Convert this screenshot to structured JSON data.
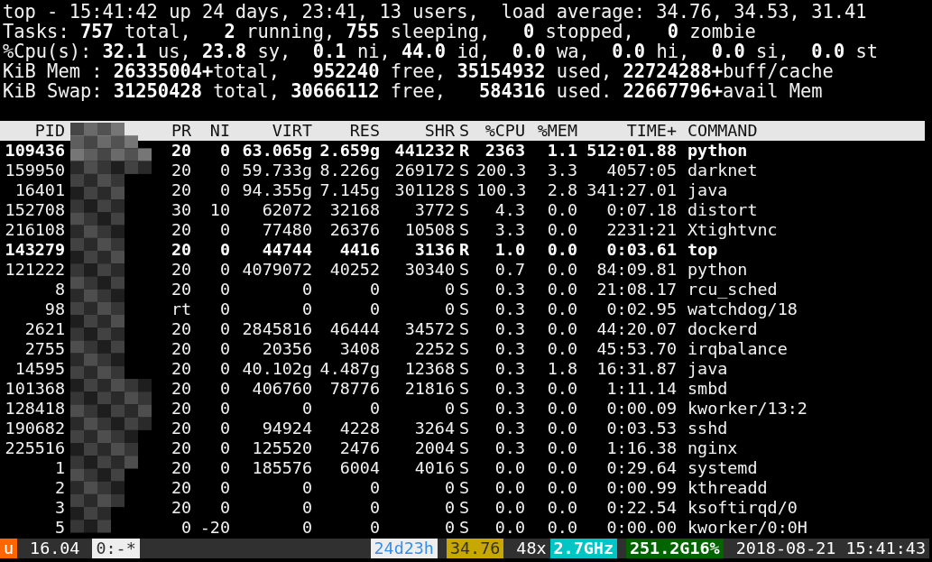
{
  "summary": [
    "top - 15:41:42 up 24 days, 23:41, 13 users,  load average: 34.76, 34.53, 31.41",
    "Tasks: **757** total,   **2** running, **755** sleeping,   **0** stopped,   **0** zombie",
    "%Cpu(s): **32.1** us, **23.8** sy,  **0.1** ni, **44.0** id,  **0.0** wa,  **0.0** hi,  **0.0** si,  **0.0** st",
    "KiB Mem : **26335004+**total,   **952240** free, **35154932** used, **22724288+**buff/cache",
    "KiB Swap: **31250428** total, **30666112** free,   **584316** used. **22667796+**avail Mem"
  ],
  "table": {
    "columns": [
      "PID",
      "PR",
      "NI",
      "VIRT",
      "RES",
      "SHR",
      "S",
      "%CPU",
      "%MEM",
      "TIME+",
      "COMMAND"
    ],
    "rows": [
      {
        "cells": [
          "109436",
          "20",
          "0",
          "63.065g",
          "2.659g",
          "441232",
          "R",
          "2363",
          "1.1",
          "512:01.88",
          "python"
        ],
        "bold": true
      },
      {
        "cells": [
          "159950",
          "20",
          "0",
          "59.733g",
          "8.226g",
          "269172",
          "S",
          "200.3",
          "3.3",
          "4057:05",
          "darknet"
        ],
        "bold": false
      },
      {
        "cells": [
          "16401",
          "20",
          "0",
          "94.355g",
          "7.145g",
          "301128",
          "S",
          "100.3",
          "2.8",
          "341:27.01",
          "java"
        ],
        "bold": false
      },
      {
        "cells": [
          "152708",
          "30",
          "10",
          "62072",
          "32168",
          "3772",
          "S",
          "4.3",
          "0.0",
          "0:07.18",
          "distort"
        ],
        "bold": false
      },
      {
        "cells": [
          "216108",
          "20",
          "0",
          "77480",
          "26376",
          "10508",
          "S",
          "3.3",
          "0.0",
          "2231:21",
          "Xtightvnc"
        ],
        "bold": false
      },
      {
        "cells": [
          "143279",
          "20",
          "0",
          "44744",
          "4416",
          "3136",
          "R",
          "1.0",
          "0.0",
          "0:03.61",
          "top"
        ],
        "bold": true
      },
      {
        "cells": [
          "121222",
          "20",
          "0",
          "4079072",
          "40252",
          "30340",
          "S",
          "0.7",
          "0.0",
          "84:09.81",
          "python"
        ],
        "bold": false
      },
      {
        "cells": [
          "8",
          "20",
          "0",
          "0",
          "0",
          "0",
          "S",
          "0.3",
          "0.0",
          "21:08.17",
          "rcu_sched"
        ],
        "bold": false
      },
      {
        "cells": [
          "98",
          "rt",
          "0",
          "0",
          "0",
          "0",
          "S",
          "0.3",
          "0.0",
          "0:02.95",
          "watchdog/18"
        ],
        "bold": false
      },
      {
        "cells": [
          "2621",
          "20",
          "0",
          "2845816",
          "46444",
          "34572",
          "S",
          "0.3",
          "0.0",
          "44:20.07",
          "dockerd"
        ],
        "bold": false
      },
      {
        "cells": [
          "2755",
          "20",
          "0",
          "20356",
          "3408",
          "2252",
          "S",
          "0.3",
          "0.0",
          "45:53.70",
          "irqbalance"
        ],
        "bold": false
      },
      {
        "cells": [
          "14595",
          "20",
          "0",
          "40.102g",
          "4.487g",
          "12368",
          "S",
          "0.3",
          "1.8",
          "16:31.87",
          "java"
        ],
        "bold": false
      },
      {
        "cells": [
          "101368",
          "20",
          "0",
          "406760",
          "78776",
          "21816",
          "S",
          "0.3",
          "0.0",
          "1:11.14",
          "smbd"
        ],
        "bold": false
      },
      {
        "cells": [
          "128418",
          "20",
          "0",
          "0",
          "0",
          "0",
          "S",
          "0.3",
          "0.0",
          "0:00.09",
          "kworker/13:2"
        ],
        "bold": false
      },
      {
        "cells": [
          "190682",
          "20",
          "0",
          "94924",
          "4228",
          "3264",
          "S",
          "0.3",
          "0.0",
          "0:03.53",
          "sshd"
        ],
        "bold": false
      },
      {
        "cells": [
          "225516",
          "20",
          "0",
          "125520",
          "2476",
          "2004",
          "S",
          "0.3",
          "0.0",
          "1:16.38",
          "nginx"
        ],
        "bold": false
      },
      {
        "cells": [
          "1",
          "20",
          "0",
          "185576",
          "6004",
          "4016",
          "S",
          "0.0",
          "0.0",
          "0:29.64",
          "systemd"
        ],
        "bold": false
      },
      {
        "cells": [
          "2",
          "20",
          "0",
          "0",
          "0",
          "0",
          "S",
          "0.0",
          "0.0",
          "0:00.99",
          "kthreadd"
        ],
        "bold": false
      },
      {
        "cells": [
          "3",
          "20",
          "0",
          "0",
          "0",
          "0",
          "S",
          "0.0",
          "0.0",
          "0:22.54",
          "ksoftirqd/0"
        ],
        "bold": false
      },
      {
        "cells": [
          "5",
          "0",
          "-20",
          "0",
          "0",
          "0",
          "S",
          "0.0",
          "0.0",
          "0:00.00",
          "kworker/0:0H"
        ],
        "bold": false
      }
    ]
  },
  "status_bar": {
    "left": [
      {
        "text": "u",
        "color": "#ff6600",
        "kind": "light",
        "bold": false
      },
      {
        "text": "16.04",
        "color": "#303030",
        "kind": "light",
        "bold": false
      },
      {
        "text": "0:-*",
        "color": "#eeeeee",
        "kind": "dark",
        "bold": false
      }
    ],
    "right": [
      {
        "text": "24d23h",
        "color": "#eeeeee",
        "kind": "blue",
        "bold": false
      },
      {
        "text": "34.76",
        "color": "#c8a800",
        "kind": "dark",
        "bold": false
      },
      {
        "text": "48x",
        "color": "#303030",
        "kind": "light",
        "bold": false
      },
      {
        "text": "2.7GHz",
        "color": "#00c5c5",
        "kind": "light",
        "bold": true
      },
      {
        "text": "251.2G16%",
        "color": "#006400",
        "kind": "light",
        "bold": true
      },
      {
        "text": "2018-08-21 15:41:43",
        "color": "#303030",
        "kind": "light",
        "bold": false
      }
    ]
  }
}
